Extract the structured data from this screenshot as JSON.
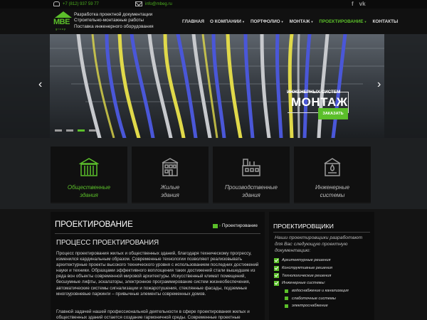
{
  "topbar": {
    "phone": "+7 (812) 937 59 77",
    "email": "info@mbeg.ru",
    "social": [
      "f",
      "vk"
    ]
  },
  "header": {
    "logo_text": "MBE",
    "logo_sub": "group",
    "tagline": [
      "Разработка проектной документации",
      "Строительно-монтажные работы",
      "Поставка инженерного оборудования"
    ],
    "nav": [
      {
        "label": "ГЛАВНАЯ",
        "dropdown": false,
        "active": false
      },
      {
        "label": "О КОМПАНИИ",
        "dropdown": true,
        "active": false
      },
      {
        "label": "ПОРТФОЛИО",
        "dropdown": true,
        "active": false
      },
      {
        "label": "МОНТАЖ",
        "dropdown": true,
        "active": false
      },
      {
        "label": "ПРОЕКТИРОВАНИЕ",
        "dropdown": true,
        "active": true
      },
      {
        "label": "КОНТАКТЫ",
        "dropdown": false,
        "active": false
      }
    ]
  },
  "slider": {
    "caption_small": "ИНЖЕНЕРНЫХ СИСТЕМ",
    "caption_big": "МОНТАЖ",
    "button": "ЗАКАЗАТЬ",
    "slides": 4,
    "active_slide": 3,
    "arrow_prev": "‹",
    "arrow_next": "›"
  },
  "categories": [
    {
      "line1": "Общественные",
      "line2": "здания",
      "icon": "public-building-icon",
      "active": true
    },
    {
      "line1": "Жилые",
      "line2": "здания",
      "icon": "residential-building-icon",
      "active": false
    },
    {
      "line1": "Производственные",
      "line2": "здания",
      "icon": "industrial-building-icon",
      "active": false
    },
    {
      "line1": "Инженерные",
      "line2": "системы",
      "icon": "engineering-systems-icon",
      "active": false
    }
  ],
  "content": {
    "title": "ПРОЕКТИРОВАНИЕ",
    "breadcrumb": "Проектирование",
    "subtitle": "ПРОЦЕСС ПРОЕКТИРОВАНИЯ",
    "paragraph1": "Процесс проектирования жилых и общественных зданий, благодаря техническому прогрессу, изменился кардинальным образом. Современные технологии позволяют реализовывать архитектурные проекты высокого технического уровня с использованием последних достижений науки и техники. Образцами эффективного воплощения таких достижений стали вышедшие из ряда вон объекты современной мировой архитектуры. Искусственный климат помещений, бесшумные лифты, эскалаторы, электронное программирование систем жизнеобеспечения, автоматические системы сигнализации и пожаротушения, стеклянные фасады, подземные многоуровневые паркинги – привычные элементы современных домов.",
    "paragraph2": "Главной задачей нашей профессиональной деятельности в сфере проектирования жилых и общественных зданий остается создание гармоничной среды. Современные проектные"
  },
  "sidebar": {
    "title": "ПРОЕКТИРОВЩИКИ",
    "intro": "Наши проектировщики разработают для Вас следующую проектную документацию:",
    "items": [
      {
        "label": "Архитектурные решения",
        "sub": false
      },
      {
        "label": "Конструктивные решения",
        "sub": false
      },
      {
        "label": "Технологические решения",
        "sub": false
      },
      {
        "label": "Инженерные системы:",
        "sub": false
      },
      {
        "label": "водоснабжение и канализация",
        "sub": true
      },
      {
        "label": "слаботочные системы",
        "sub": true
      },
      {
        "label": "электроснабжение",
        "sub": true
      }
    ]
  },
  "colors": {
    "accent": "#5bbf2a",
    "background": "#141414",
    "panel": "#0d0d0d"
  }
}
